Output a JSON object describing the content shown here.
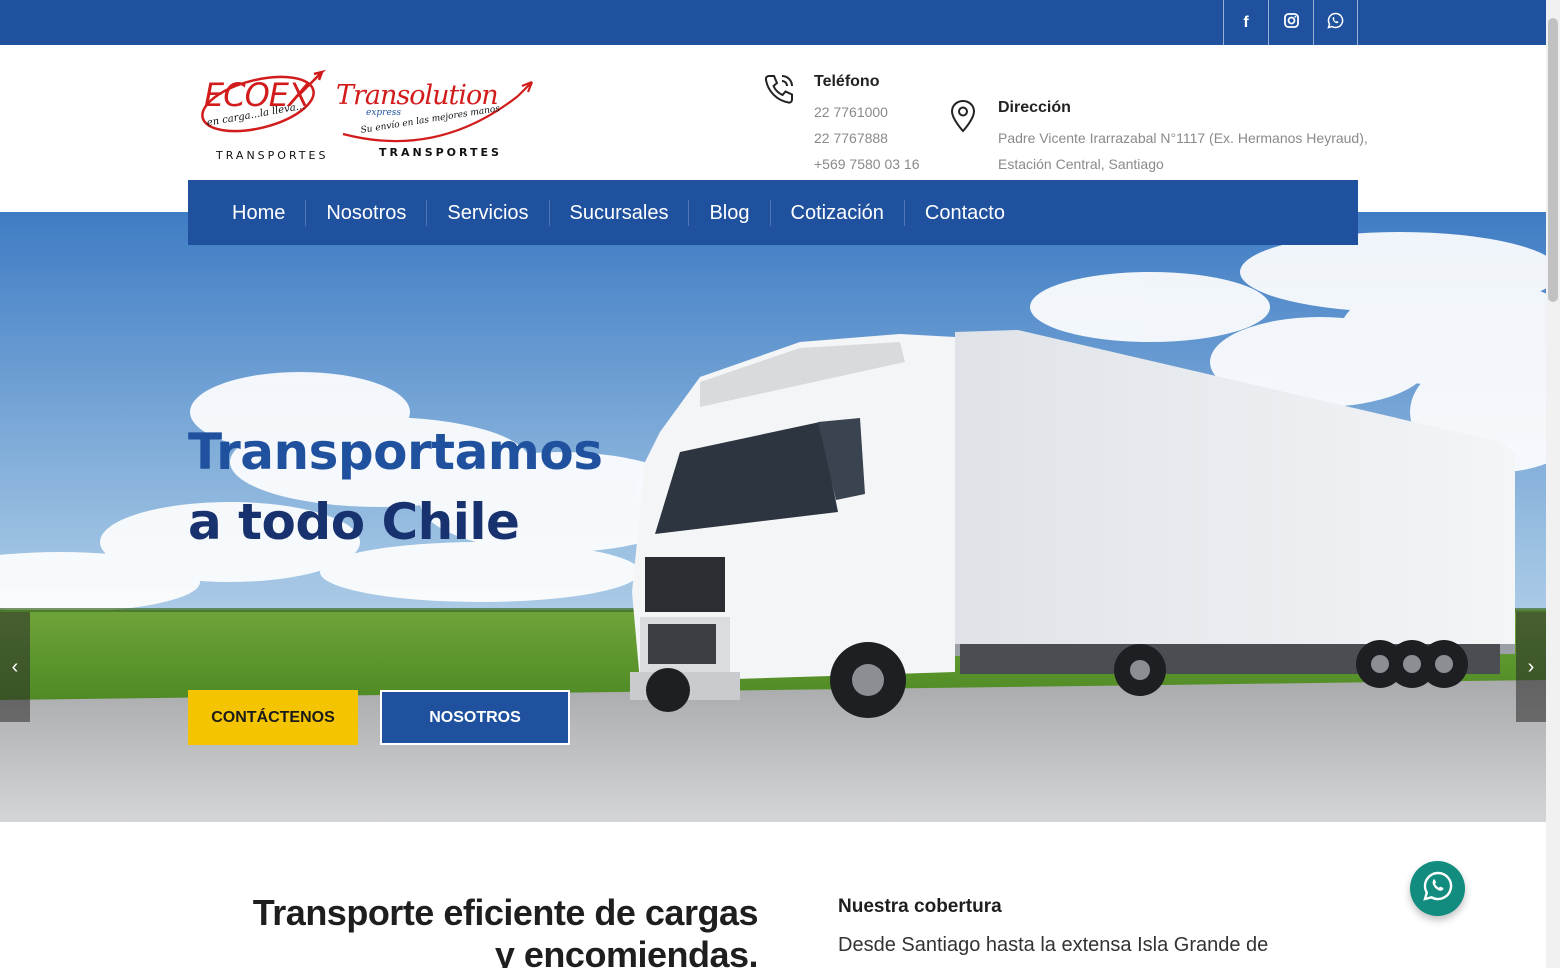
{
  "social": [
    {
      "icon": "facebook-icon",
      "glyph": "f"
    },
    {
      "icon": "instagram-icon",
      "glyph": "◎"
    },
    {
      "icon": "whatsapp-icon",
      "glyph": "✆"
    }
  ],
  "header": {
    "logo1": {
      "name": "ECOEX",
      "tagline": "en carga...la lleva...",
      "sub": "TRANSPORTES"
    },
    "logo2": {
      "name": "Transolution",
      "small": "express",
      "tagline": "Su envío en las mejores manos",
      "sub": "TRANSPORTES"
    },
    "phone": {
      "title": "Teléfono",
      "lines": [
        "22 7761000",
        "22 7767888",
        "+569 7580 03 16"
      ]
    },
    "address": {
      "title": "Dirección",
      "lines": [
        "Padre Vicente Irarrazabal N°1117 (Ex. Hermanos Heyraud),",
        "Estación Central, Santiago"
      ]
    }
  },
  "nav": {
    "items": [
      "Home",
      "Nosotros",
      "Servicios",
      "Sucursales",
      "Blog",
      "Cotización",
      "Contacto"
    ]
  },
  "hero": {
    "title_line1": "Transportamos",
    "title_line2": "a todo Chile",
    "btn_primary": "CONTÁCTENOS",
    "btn_secondary": "NOSOTROS",
    "prev": "‹",
    "next": "›"
  },
  "section": {
    "heading": "Transporte eficiente de cargas y encomiendas.",
    "coverage_title": "Nuestra cobertura",
    "coverage_text": "Desde Santiago hasta la extensa Isla Grande de"
  },
  "colors": {
    "brand_blue": "#1f519e",
    "dark_blue": "#17326e",
    "accent_yellow": "#f5c400",
    "whatsapp_green": "#128c7e"
  }
}
